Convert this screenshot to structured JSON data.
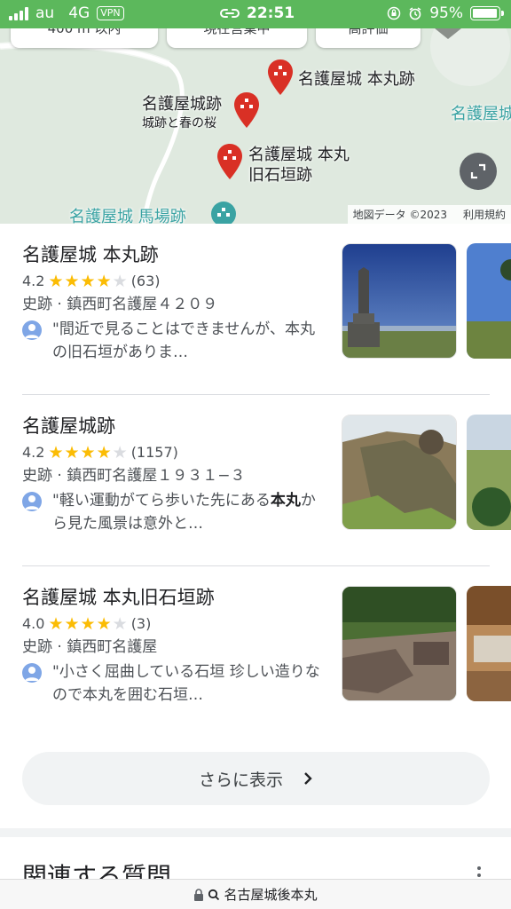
{
  "status_bar": {
    "carrier": "au",
    "network": "4G",
    "vpn": "VPN",
    "time": "22:51",
    "battery": "95%",
    "battery_level": 0.95
  },
  "map": {
    "chips": [
      "400 m 以内",
      "現在営業中",
      "高評価"
    ],
    "pins": [
      {
        "label": "名護屋城 本丸跡",
        "sublabel": ""
      },
      {
        "label": "名護屋城跡",
        "sublabel": "城跡と春の桜"
      },
      {
        "label": "名護屋城 本丸",
        "sublabel": "旧石垣跡"
      }
    ],
    "other_labels": [
      "名護屋城 馬場跡",
      "名護屋城"
    ],
    "attribution": "地図データ ©2023",
    "terms": "利用規約"
  },
  "results": [
    {
      "title": "名護屋城 本丸跡",
      "rating": "4.2",
      "stars": 4,
      "reviews": "(63)",
      "meta": "史跡 · 鎮西町名護屋４２０９",
      "review_text": "\"間近で見ることはできませんが、本丸の旧石垣がありま…",
      "review_bold": "",
      "review_rest": ""
    },
    {
      "title": "名護屋城跡",
      "rating": "4.2",
      "stars": 4,
      "reviews": "(1157)",
      "meta": "史跡 · 鎮西町名護屋１９３１−３",
      "review_text": "\"軽い運動がてら歩いた先にある",
      "review_bold": "本丸",
      "review_rest": "から見た風景は意外と…"
    },
    {
      "title": "名護屋城 本丸旧石垣跡",
      "rating": "4.0",
      "stars": 4,
      "reviews": "(3)",
      "meta": "史跡 · 鎮西町名護屋",
      "review_text": "\"小さく屈曲している石垣 珍しい造りなので本丸を囲む石垣…",
      "review_bold": "",
      "review_rest": ""
    }
  ],
  "more_button": "さらに表示",
  "faq_title": "関連する質問",
  "url_text": "名古屋城後本丸",
  "colors": {
    "status_green": "#5cb85c",
    "pin_red": "#d93025",
    "star": "#fbbc04"
  }
}
